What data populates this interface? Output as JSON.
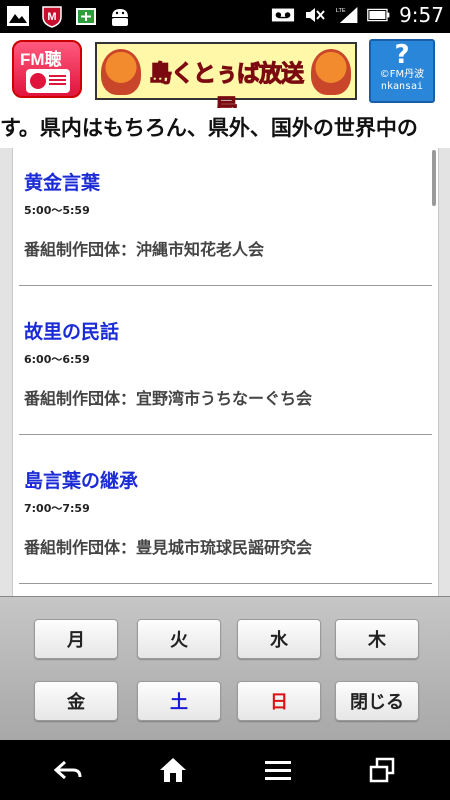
{
  "status_bar": {
    "time": "9:57",
    "left_icons": [
      "image-icon",
      "mcafee-icon",
      "app-store-icon",
      "android-icon"
    ],
    "right_icons": [
      "voicemail-icon",
      "mute-icon",
      "lte-signal-icon",
      "battery-icon"
    ],
    "lte_label": "LTE"
  },
  "header": {
    "logo_text": "FM聴",
    "banner_title": "島くとぅば放送局",
    "help_mark": "?",
    "help_caption_1": "©FM丹波",
    "help_caption_2": "nkansai"
  },
  "ticker": {
    "text": "す。県内はもちろん、県外、国外の世界中の"
  },
  "programs": [
    {
      "title": "黄金言葉",
      "time": "5:00～5:59",
      "organizer": "番組制作団体：沖縄市知花老人会"
    },
    {
      "title": "故里の民話",
      "time": "6:00～6:59",
      "organizer": "番組制作団体：宜野湾市うちなーぐち会"
    },
    {
      "title": "島言葉の継承",
      "time": "7:00～7:59",
      "organizer": "番組制作団体：豊見城市琉球民謡研究会"
    }
  ],
  "day_buttons": {
    "mon": "月",
    "tue": "火",
    "wed": "水",
    "thu": "木",
    "fri": "金",
    "sat": "土",
    "sun": "日",
    "close": "閉じる"
  },
  "colors": {
    "title_blue": "#1b2bd6",
    "saturday_blue": "#1a1ad6",
    "sunday_red": "#e01010",
    "banner_red": "#e8122e",
    "help_blue": "#2a86d8"
  },
  "nav_icons": [
    "back-icon",
    "home-icon",
    "menu-icon",
    "recent-apps-icon"
  ]
}
